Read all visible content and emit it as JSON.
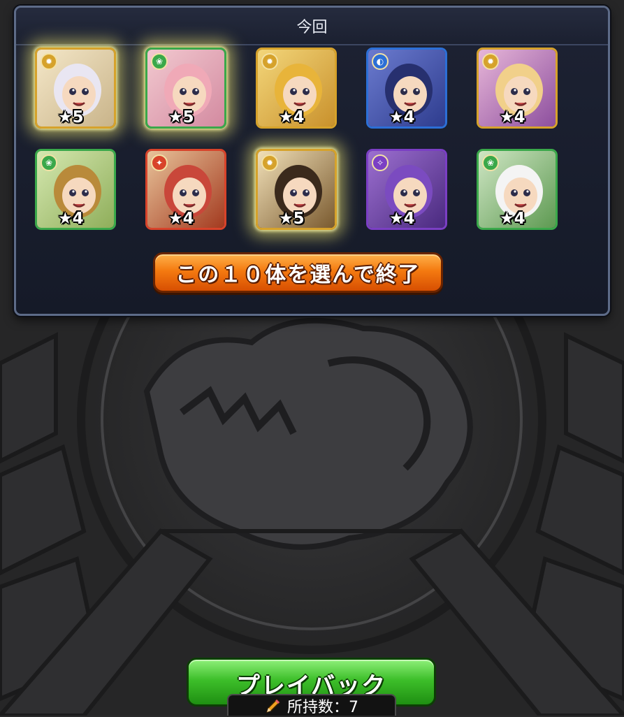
{
  "header": {
    "title": "今回"
  },
  "cards": [
    {
      "stars": "★5",
      "glow": true,
      "element": "light",
      "bg": [
        "#f4e7c8",
        "#c9b48a"
      ],
      "hair": "#e9e6f2"
    },
    {
      "stars": "★5",
      "glow": true,
      "element": "wood",
      "bg": [
        "#f2c9d0",
        "#d38aa0"
      ],
      "hair": "#f0a9b7"
    },
    {
      "stars": "★4",
      "glow": false,
      "element": "light",
      "bg": [
        "#f3d67a",
        "#c9912c"
      ],
      "hair": "#e8b43a"
    },
    {
      "stars": "★4",
      "glow": false,
      "element": "water",
      "bg": [
        "#6b7bcf",
        "#2e3c8e"
      ],
      "hair": "#27306f"
    },
    {
      "stars": "★4",
      "glow": false,
      "element": "light",
      "bg": [
        "#e7b6d8",
        "#8d4f9e"
      ],
      "hair": "#f1d08a"
    },
    {
      "stars": "★4",
      "glow": false,
      "element": "wood",
      "bg": [
        "#d5e8b0",
        "#8fae5a"
      ],
      "hair": "#b98a3a"
    },
    {
      "stars": "★4",
      "glow": false,
      "element": "fire",
      "bg": [
        "#e8c39a",
        "#a33a1f"
      ],
      "hair": "#c9473a"
    },
    {
      "stars": "★5",
      "glow": true,
      "element": "light",
      "bg": [
        "#f1e0b8",
        "#7a5a2f"
      ],
      "hair": "#3b2a1c"
    },
    {
      "stars": "★4",
      "glow": false,
      "element": "dark",
      "bg": [
        "#9c6fd0",
        "#4a2a7f"
      ],
      "hair": "#7b4bc0"
    },
    {
      "stars": "★4",
      "glow": false,
      "element": "wood",
      "bg": [
        "#cfe6c4",
        "#5e9a52"
      ],
      "hair": "#f4f4f4"
    }
  ],
  "element_colors": {
    "light": "#d6a22b",
    "wood": "#3aa84a",
    "water": "#2c6fd6",
    "fire": "#d8432a",
    "dark": "#7b3fc4"
  },
  "element_glyphs": {
    "light": "✹",
    "wood": "❀",
    "water": "◐",
    "fire": "✦",
    "dark": "✧"
  },
  "select_button": {
    "label": "この１０体を選んで終了"
  },
  "playback_button": {
    "label": "プレイバック"
  },
  "count": {
    "label": "所持数：7"
  }
}
